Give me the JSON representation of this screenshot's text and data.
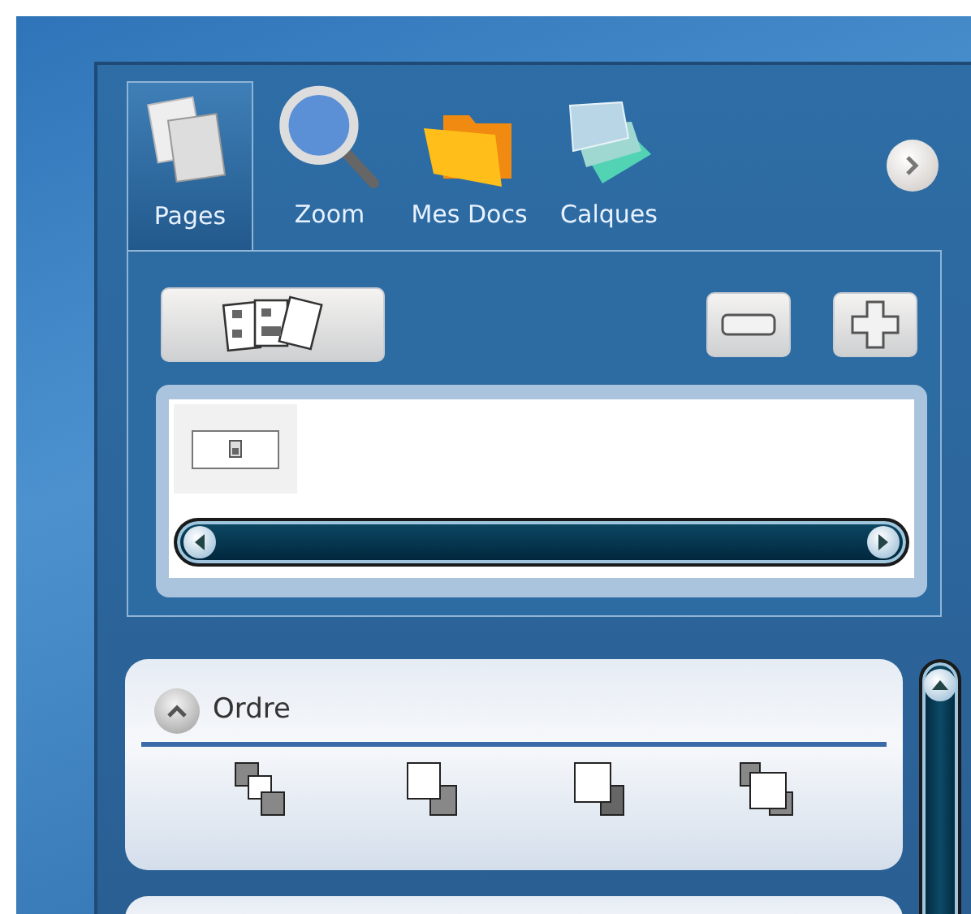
{
  "toolbar": {
    "tabs": [
      {
        "label": "Pages",
        "selected": true
      },
      {
        "label": "Zoom",
        "selected": false
      },
      {
        "label": "Mes Docs",
        "selected": false
      },
      {
        "label": "Calques",
        "selected": false
      }
    ]
  },
  "sections": [
    {
      "title": "Ordre",
      "expanded": true
    }
  ]
}
